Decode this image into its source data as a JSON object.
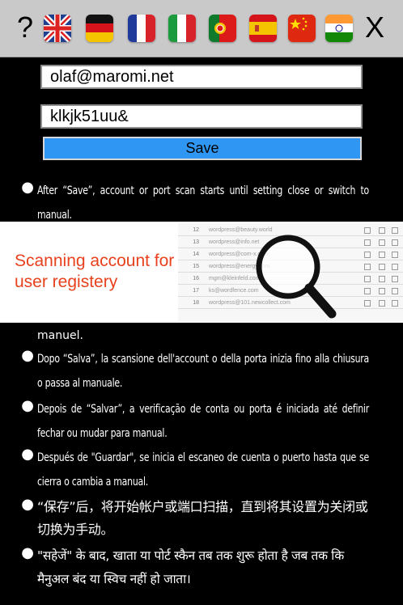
{
  "toolbar": {
    "help_label": "?",
    "close_label": "X",
    "languages": [
      {
        "code": "en",
        "flag": "uk-flag-icon"
      },
      {
        "code": "de",
        "flag": "germany-flag-icon"
      },
      {
        "code": "fr",
        "flag": "france-flag-icon"
      },
      {
        "code": "it",
        "flag": "italy-flag-icon"
      },
      {
        "code": "pt",
        "flag": "portugal-flag-icon"
      },
      {
        "code": "es",
        "flag": "spain-flag-icon"
      },
      {
        "code": "zh",
        "flag": "china-flag-icon"
      },
      {
        "code": "hi",
        "flag": "india-flag-icon"
      }
    ]
  },
  "form": {
    "email_value": "olaf@maromi.net",
    "password_value": "klkjk51uu&",
    "save_label": "Save"
  },
  "colors": {
    "background": "#000000",
    "toolbar": "#c9c9c9",
    "save_button": "#2f96f3",
    "banner_text": "#e8411d"
  },
  "banner": {
    "text": "Scanning account for user registery",
    "rows": [
      "12",
      "13",
      "14",
      "15",
      "16",
      "17",
      "18"
    ],
    "row_texts": [
      "wordpress@beauty.world",
      "wordpress@info.net",
      "wordpress@com-x.com",
      "wordpress@energy.com",
      "mgm@kleinfeld.com",
      "ks@wordfence.com",
      "wordpress@101.newcollect.com"
    ]
  },
  "instructions": {
    "en": "After “Save”, account or port scan starts until setting close or switch to manual.",
    "fr_tail": "manuel.",
    "it": "Dopo “Salva”, la scansione dell'account o della porta inizia fino alla chiusura o passa al manuale.",
    "pt": "Depois de “Salvar”, a verificação de conta ou porta é iniciada até definir fechar ou mudar para manual.",
    "es": "Después de \"Guardar\", se inicia el escaneo de cuenta o puerto hasta que se cierra o cambia a manual.",
    "zh": "“保存”后，将开始帐户或端口扫描，直到将其设置为关闭或切换为手动。",
    "hi": "\"सहेजें\" के बाद, खाता या पोर्ट स्कैन तब तक शुरू होता है जब तक कि मैनुअल बंद या स्विच नहीं हो जाता।"
  }
}
